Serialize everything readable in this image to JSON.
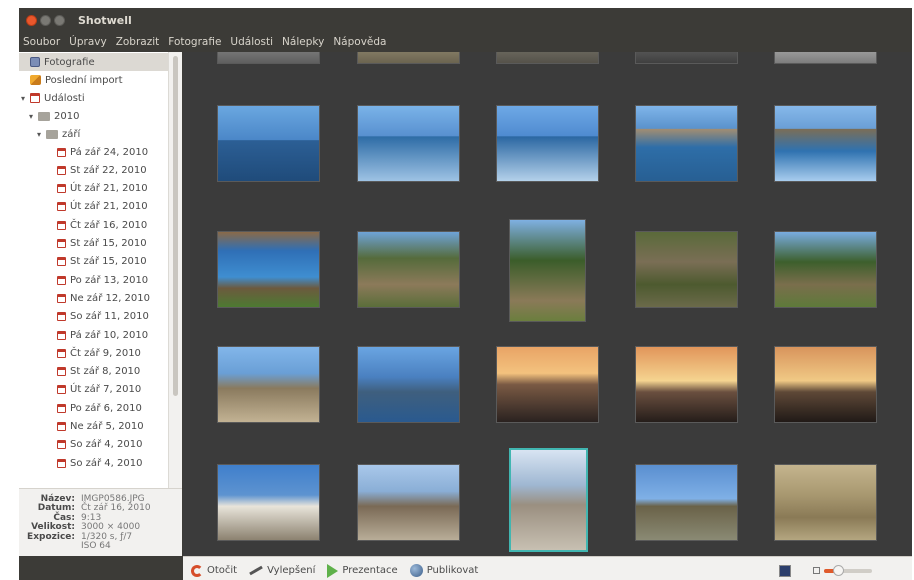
{
  "window": {
    "title": "Shotwell"
  },
  "menubar": [
    "Soubor",
    "Úpravy",
    "Zobrazit",
    "Fotografie",
    "Události",
    "Nálepky",
    "Nápověda"
  ],
  "sidebar": {
    "photos": "Fotografie",
    "last_import": "Poslední import",
    "events": "Události",
    "year": "2010",
    "month": "září",
    "days": [
      "Pá zář 24, 2010",
      "St zář 22, 2010",
      "Út zář 21, 2010",
      "Út zář 21, 2010",
      "Čt zář 16, 2010",
      "St zář 15, 2010",
      "St zář 15, 2010",
      "Po zář 13, 2010",
      "Ne zář 12, 2010",
      "So zář 11, 2010",
      "Pá zář 10, 2010",
      "Čt zář 9, 2010",
      "St zář 8, 2010",
      "Út zář 7, 2010",
      "Po zář 6, 2010",
      "Ne zář 5, 2010",
      "So zář 4, 2010",
      "So zář 4, 2010"
    ]
  },
  "metadata": {
    "name_key": "Název:",
    "name_val": "IMGP0586.JPG",
    "date_key": "Datum:",
    "date_val": "Čt zář 16, 2010",
    "time_key": "Čas:",
    "time_val": "9:13",
    "size_key": "Velikost:",
    "size_val": "3000 × 4000",
    "exposure_key": "Expozice:",
    "exposure_val": "1/320 s, ƒ/7",
    "iso_val": "ISO 64"
  },
  "toolbar": {
    "rotate": "Otočit",
    "enhance": "Vylepšení",
    "slideshow": "Prezentace",
    "publish": "Publikovat"
  },
  "zoom_level": 0.3,
  "colors": {
    "selection": "#41b6b1",
    "accent": "#e05a2b",
    "viewer_bg": "#3b3b3b"
  },
  "thumbnails": [
    {
      "name": "thumb-top-1"
    },
    {
      "name": "thumb-top-2"
    },
    {
      "name": "thumb-top-3"
    },
    {
      "name": "thumb-top-4"
    },
    {
      "name": "thumb-top-5"
    },
    {
      "name": "thumb-lake-1"
    },
    {
      "name": "thumb-lake-2"
    },
    {
      "name": "thumb-lake-3"
    },
    {
      "name": "thumb-lake-4"
    },
    {
      "name": "thumb-lake-5"
    },
    {
      "name": "thumb-map-sign"
    },
    {
      "name": "thumb-garden"
    },
    {
      "name": "thumb-trees"
    },
    {
      "name": "thumb-ruins"
    },
    {
      "name": "thumb-hill"
    },
    {
      "name": "thumb-shore"
    },
    {
      "name": "thumb-mountain"
    },
    {
      "name": "thumb-sunset-1"
    },
    {
      "name": "thumb-sunset-2"
    },
    {
      "name": "thumb-sunset-3"
    },
    {
      "name": "thumb-church"
    },
    {
      "name": "thumb-plaza"
    },
    {
      "name": "thumb-selected"
    },
    {
      "name": "thumb-plain"
    },
    {
      "name": "thumb-llamas"
    }
  ]
}
